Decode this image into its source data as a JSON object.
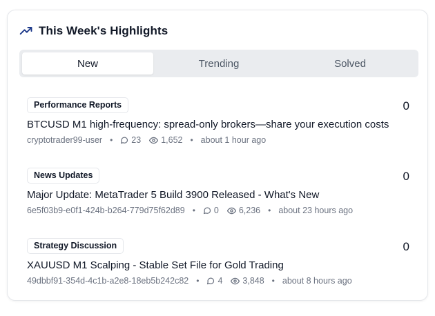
{
  "header": {
    "title": "This Week's Highlights",
    "icon": "trending-up-icon"
  },
  "tabs": [
    {
      "label": "New",
      "active": true
    },
    {
      "label": "Trending",
      "active": false
    },
    {
      "label": "Solved",
      "active": false
    }
  ],
  "posts": [
    {
      "category": "Performance Reports",
      "title": "BTCUSD M1 high-frequency: spread-only brokers—share your execution costs",
      "author": "cryptotrader99-user",
      "comments": "23",
      "views": "1,652",
      "time": "about 1 hour ago",
      "count": "0"
    },
    {
      "category": "News Updates",
      "title": "Major Update: MetaTrader 5 Build 3900 Released - What's New",
      "author": "6e5f03b9-e0f1-424b-b264-779d75f62d89",
      "comments": "0",
      "views": "6,236",
      "time": "about 23 hours ago",
      "count": "0"
    },
    {
      "category": "Strategy Discussion",
      "title": "XAUUSD M1 Scalping - Stable Set File for Gold Trading",
      "author": "49dbbf91-354d-4c1b-a2e8-18eb5b242c82",
      "comments": "4",
      "views": "3,848",
      "time": "about 8 hours ago",
      "count": "0"
    }
  ],
  "separator": "•",
  "colors": {
    "accent": "#1e3a8a",
    "tab_bg": "#eaecef",
    "muted_text": "#6b7280",
    "border": "#e5e7eb"
  }
}
